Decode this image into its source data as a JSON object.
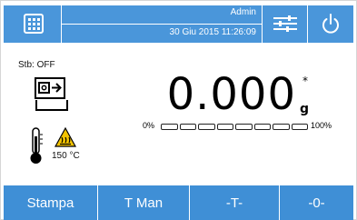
{
  "header": {
    "user": "Admin",
    "datetime": "30 Giu 2015 11:26:09"
  },
  "icons": {
    "menu": "grid-icon",
    "settings": "sliders-icon",
    "power": "power-icon",
    "tare": "tare-icon",
    "thermometer": "thermometer-icon",
    "warning": "hot-surface-warning-icon"
  },
  "status": {
    "stability": "Stb: OFF",
    "temperature": "150 °C"
  },
  "display": {
    "weight": "0.000",
    "star": "*",
    "unit": "g",
    "range_min": "0%",
    "range_max": "100%",
    "load_fraction": 0
  },
  "footer": {
    "buttons": [
      "Stampa",
      "T Man",
      "-T-",
      "-0-"
    ]
  },
  "colors": {
    "accent": "#3f8fd6",
    "warning": "#f4c400"
  }
}
